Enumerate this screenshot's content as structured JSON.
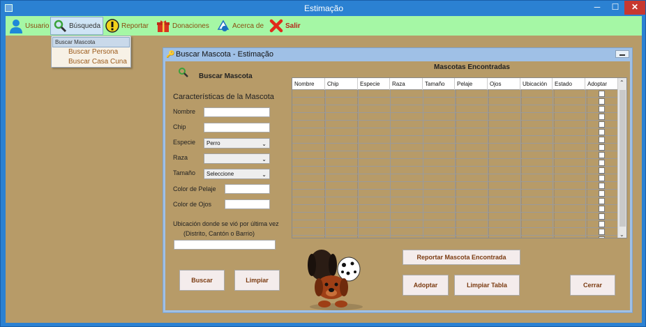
{
  "window": {
    "title": "Estimação"
  },
  "menu": {
    "items": [
      {
        "label": "Usuario",
        "icon": "user-icon"
      },
      {
        "label": "Búsqueda",
        "icon": "search-icon"
      },
      {
        "label": "Reportar",
        "icon": "warning-icon"
      },
      {
        "label": "Donaciones",
        "icon": "gift-icon"
      },
      {
        "label": "Acerca de",
        "icon": "info-icon"
      },
      {
        "label": "Salir",
        "icon": "exit-icon"
      }
    ],
    "dropdown": [
      "Buscar Mascota",
      "Buscar Persona",
      "Buscar Casa Cuna"
    ]
  },
  "frame": {
    "title": "Buscar Mascota - Estimação",
    "heading": "Buscar Mascota",
    "section": "Características de la Mascota",
    "fields": {
      "nombre": "Nombre",
      "chip": "Chip",
      "especie": "Especie",
      "especie_value": "Perro",
      "raza": "Raza",
      "raza_value": "",
      "tamano": "Tamaño",
      "tamano_value": "Seleccione",
      "pelaje": "Color de Pelaje",
      "ojos": "Color de Ojos",
      "ubicacion": "Ubicación donde se vió por última vez",
      "ubicacion_hint": "(Distrito, Cantón o Barrio)"
    },
    "table": {
      "title": "Mascotas Encontradas",
      "columns": [
        "Nombre",
        "Chip",
        "Especie",
        "Raza",
        "Tamaño",
        "Pelaje",
        "Ojos",
        "Ubicación",
        "Estado",
        "Adoptar"
      ],
      "row_count": 20
    },
    "buttons": {
      "buscar": "Buscar",
      "limpiar": "Limpiar",
      "reportar": "Reportar Mascota Encontrada",
      "adoptar": "Adoptar",
      "limpiar_tabla": "Limpiar Tabla",
      "cerrar": "Cerrar"
    }
  },
  "colors": {
    "menubar": "#a5f7a5",
    "desktop": "#b79b68",
    "titlebar": "#2b81d2",
    "accent_text": "#8a4d10"
  }
}
